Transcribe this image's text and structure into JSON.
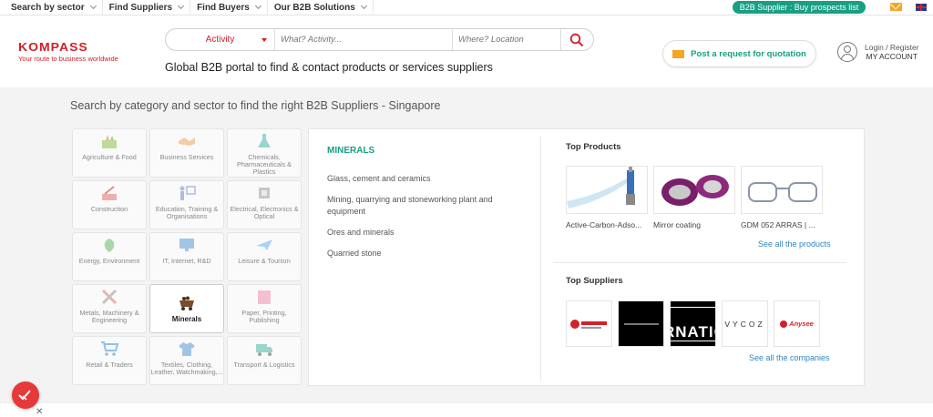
{
  "topbar": {
    "nav": [
      "Search by sector",
      "Find Suppliers",
      "Find Buyers",
      "Our B2B Solutions"
    ],
    "b2b_pill": "B2B Supplier : Buy prospects list"
  },
  "header": {
    "logo": "KOMPASS",
    "logo_tagline": "Your route to business worldwide",
    "search": {
      "selector": "Activity",
      "what_placeholder": "What? Activity...",
      "where_placeholder": "Where? Location"
    },
    "tagline": "Global B2B portal to find & contact products or services suppliers",
    "rfq_label": "Post a request for quotation",
    "account": {
      "line1": "Login / Register",
      "line2": "MY ACCOUNT"
    }
  },
  "main": {
    "heading": "Search by category and sector to find the right B2B Suppliers - Singapore",
    "categories": [
      {
        "label": "Agriculture & Food",
        "icon": "agriculture-icon",
        "color": "#8bc34a"
      },
      {
        "label": "Business Services",
        "icon": "handshake-icon",
        "color": "#f0a860"
      },
      {
        "label": "Chemicals, Pharmaceuticals & Plastics",
        "icon": "flask-icon",
        "color": "#4db6ac"
      },
      {
        "label": "Construction",
        "icon": "construction-icon",
        "color": "#e57373"
      },
      {
        "label": "Education, Training & Organisations",
        "icon": "teacher-icon",
        "color": "#7986cb"
      },
      {
        "label": "Electrical, Electronics & Optical",
        "icon": "chip-icon",
        "color": "#9e9e9e"
      },
      {
        "label": "Energy, Environment",
        "icon": "leaf-icon",
        "color": "#66bb6a"
      },
      {
        "label": "IT, Internet, R&D",
        "icon": "monitor-icon",
        "color": "#5c9bd5"
      },
      {
        "label": "Leisure & Tourism",
        "icon": "plane-icon",
        "color": "#64b5f6"
      },
      {
        "label": "Metals, Machinery & Engineering",
        "icon": "tools-icon",
        "color": "#e57373"
      },
      {
        "label": "Minerals",
        "icon": "mine-cart-icon",
        "color": "#7b4b2a"
      },
      {
        "label": "Paper, Printing, Publishing",
        "icon": "paper-icon",
        "color": "#f48fb1"
      },
      {
        "label": "Retail & Traders",
        "icon": "cart-icon",
        "color": "#3f8fd8"
      },
      {
        "label": "Textiles, Clothing, Leather, Watchmaking,...",
        "icon": "shirt-icon",
        "color": "#5c9bd5"
      },
      {
        "label": "Transport & Logistics",
        "icon": "truck-icon",
        "color": "#4db6ac"
      }
    ],
    "panel": {
      "title": "MINERALS",
      "subcategories": [
        "Glass, cement and ceramics",
        "Mining, quarrying and stoneworking plant and equipment",
        "Ores and minerals",
        "Quarried stone"
      ],
      "top_products_title": "Top Products",
      "products": [
        "Active-Carbon-Adso...",
        "Mirror coating",
        "GDM 052 ARRAS | ..."
      ],
      "see_all_products": "See all the products",
      "top_suppliers_title": "Top Suppliers",
      "suppliers": [
        "supplier-logo-1",
        "supplier-logo-2",
        "JCS INTERNATIONAL",
        "VYCOZ",
        "Anysee"
      ],
      "see_all_companies": "See all the companies"
    }
  }
}
